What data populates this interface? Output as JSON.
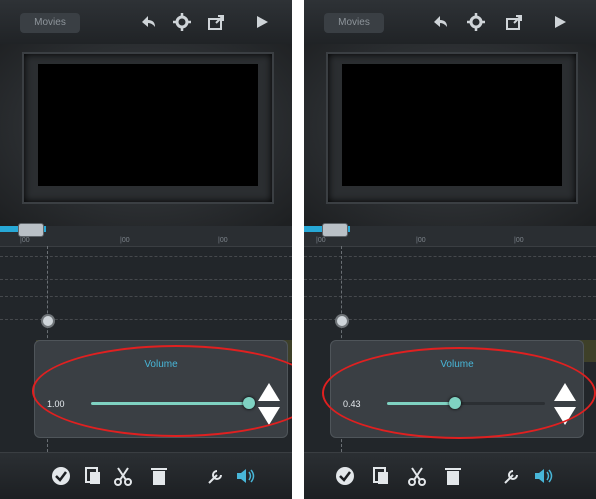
{
  "left_screen": {
    "header": {
      "title": "Movies"
    },
    "ruler_labels": [
      "|00",
      "|00",
      "|00"
    ],
    "volume_panel": {
      "title": "Volume",
      "value": "1.00",
      "level": 1.0
    }
  },
  "right_screen": {
    "header": {
      "title": "Movies"
    },
    "ruler_labels": [
      "|00",
      "|00",
      "|00"
    ],
    "volume_panel": {
      "title": "Volume",
      "value": "0.43",
      "level": 0.43
    }
  },
  "icons": {
    "header": [
      "undo-icon",
      "settings-gear-icon",
      "share-icon",
      "play-icon"
    ],
    "bottom": [
      "checkmark-icon",
      "copy-icon",
      "cut-scissors-icon",
      "delete-trash-icon",
      "tools-icon",
      "volume-icon"
    ]
  },
  "colors": {
    "accent": "#48b6d8",
    "slider": "#7fd2c2",
    "annotation": "#e02020"
  }
}
